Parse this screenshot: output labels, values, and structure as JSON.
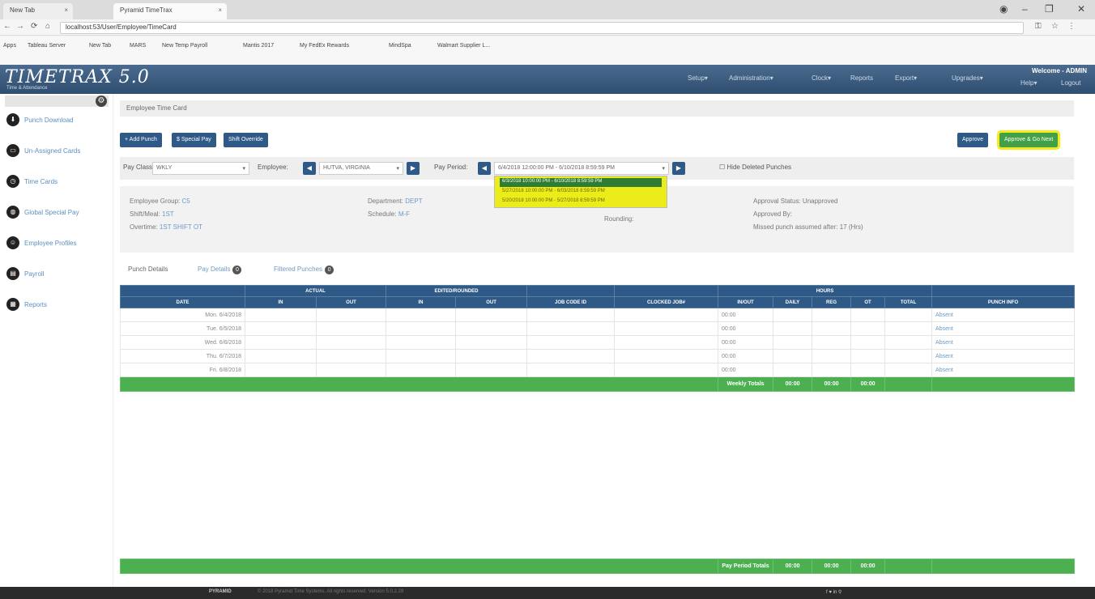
{
  "browser": {
    "tabs": [
      {
        "label": "New Tab"
      },
      {
        "label": "Pyramid TimeTrax"
      }
    ],
    "url": "localhost:53/User/Employee/TimeCard",
    "bookmarks": [
      "Apps",
      "Tableau Server",
      "New Tab",
      "MARS",
      "New Temp Payroll",
      "Mantis 2017",
      "My FedEx Rewards",
      "MindSpa",
      "Walmart Supplier L..."
    ]
  },
  "app": {
    "logo": "TIMETRAX 5.0",
    "logo_sub": "Time & Attendance",
    "nav": [
      "Setup▾",
      "Administration▾",
      "Clock▾",
      "Reports",
      "Export▾",
      "Upgrades▾",
      "Help▾",
      "Logout"
    ],
    "welcome": "Welcome - ADMIN"
  },
  "sidebar": {
    "items": [
      {
        "label": "Punch Download",
        "icon": "download-icon"
      },
      {
        "label": "Un-Assigned Cards",
        "icon": "card-icon"
      },
      {
        "label": "Time Cards",
        "icon": "clock-icon"
      },
      {
        "label": "Global Special Pay",
        "icon": "globe-icon"
      },
      {
        "label": "Employee Profiles",
        "icon": "user-icon"
      },
      {
        "label": "Payroll",
        "icon": "folder-icon"
      },
      {
        "label": "Reports",
        "icon": "report-icon"
      }
    ]
  },
  "page": {
    "breadcrumb": "Employee Time Card",
    "buttons": {
      "add_punch": "+ Add Punch",
      "special_pay": "$ Special Pay",
      "shift_override": "Shift Override",
      "approve": "Approve",
      "approve_next": "Approve & Go Next"
    },
    "filters": {
      "pay_class_label": "Pay Class:",
      "pay_class_value": "WKLY",
      "employee_label": "Employee:",
      "employee_value": "HUTVA, VIRGINIA",
      "pay_period_label": "Pay Period:",
      "pay_period_value": "6/4/2018 12:00:00 PM - 6/10/2018 8:59:59 PM",
      "hide_deleted": "Hide Deleted Punches"
    },
    "pay_period_options": [
      "6/3/2018 10:00:00 PM - 6/10/2018 8:59:59 PM",
      "5/27/2018 10:00:00 PM - 6/03/2018 8:59:59 PM",
      "5/20/2018 10:00:00 PM - 5/27/2018 8:59:59 PM"
    ],
    "info": {
      "employee_group": "Employee Group: ",
      "employee_group_v": "C5",
      "shift_meal": "Shift/Meal: ",
      "shift_meal_v": "1ST",
      "overtime": "Overtime: ",
      "overtime_v": "1ST SHIFT OT",
      "department": "Department: ",
      "department_v": "DEPT",
      "schedule": "Schedule: ",
      "schedule_v": "M-F",
      "rounding": "Rounding:",
      "approval_status": "Approval Status: Unapproved",
      "approved_by": "Approved By:",
      "missed_punch": "Missed punch assumed after: 17 (Hrs)"
    },
    "tabs": [
      {
        "label": "Punch Details"
      },
      {
        "label": "Pay Details",
        "count": "0"
      },
      {
        "label": "Filtered Punches",
        "count": "0"
      }
    ],
    "table": {
      "group_headers": [
        "ACTUAL",
        "EDITED/ROUNDED",
        "HOURS"
      ],
      "headers": [
        "DATE",
        "IN",
        "OUT",
        "IN",
        "OUT",
        "JOB CODE ID",
        "CLOCKED JOB#",
        "IN/OUT",
        "DAILY",
        "REG",
        "OT",
        "TOTAL",
        "PUNCH INFO"
      ],
      "rows": [
        {
          "date": "Mon. 6/4/2018",
          "inout": "00:00",
          "info": "Absent"
        },
        {
          "date": "Tue. 6/5/2018",
          "inout": "00:00",
          "info": "Absent"
        },
        {
          "date": "Wed. 6/6/2018",
          "inout": "00:00",
          "info": "Absent"
        },
        {
          "date": "Thu. 6/7/2018",
          "inout": "00:00",
          "info": "Absent"
        },
        {
          "date": "Fri. 6/8/2018",
          "inout": "00:00",
          "info": "Absent"
        }
      ],
      "weekly_label": "Weekly Totals",
      "weekly": [
        "00:00",
        "00:00",
        "00:00"
      ],
      "period_label": "Pay Period Totals",
      "period": [
        "00:00",
        "00:00",
        "00:00"
      ]
    },
    "footer": {
      "brand": "PYRAMID",
      "copyright": "© 2018 Pyramid Time Systems. All rights reserved. Version 5.0.2.28",
      "social": "f  ♥  in  ⚲"
    }
  }
}
